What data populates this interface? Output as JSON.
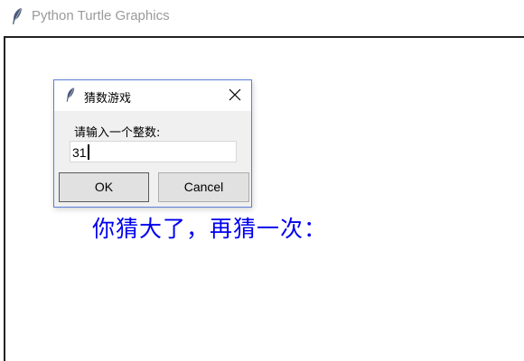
{
  "window": {
    "title": "Python Turtle Graphics",
    "icon": "feather-icon"
  },
  "canvas": {
    "message": "你猜大了，再猜一次：",
    "message_color": "#0000ee"
  },
  "dialog": {
    "title": "猜数游戏",
    "icon": "feather-icon",
    "prompt": "请输入一个整数:",
    "input_value": "31",
    "ok_label": "OK",
    "cancel_label": "Cancel",
    "border_color": "#5b7fd8"
  }
}
